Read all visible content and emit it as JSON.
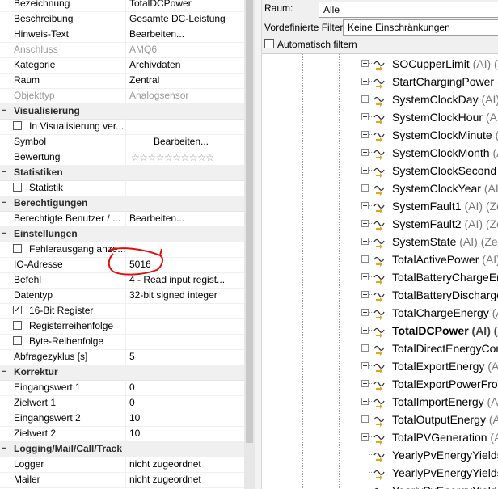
{
  "properties": {
    "rows": [
      {
        "kind": "row",
        "label": "Bezeichnung",
        "value": "TotalDCPower"
      },
      {
        "kind": "row",
        "label": "Beschreibung",
        "value": "Gesamte DC-Leistung"
      },
      {
        "kind": "row",
        "label": "Hinweis-Text",
        "value": "Bearbeiten..."
      },
      {
        "kind": "row",
        "label": "Anschluss",
        "value": "AMQ6",
        "disabled": true
      },
      {
        "kind": "row",
        "label": "Kategorie",
        "value": "Archivdaten"
      },
      {
        "kind": "row",
        "label": "Raum",
        "value": "Zentral"
      },
      {
        "kind": "row",
        "label": "Objekttyp",
        "value": "Analogsensor",
        "disabled": true
      },
      {
        "kind": "cat",
        "label": "Visualisierung",
        "expander": "−"
      },
      {
        "kind": "check",
        "label": "In Visualisierung ver...",
        "checked": false
      },
      {
        "kind": "row",
        "label": "Symbol",
        "value": "Bearbeiten...",
        "center": true
      },
      {
        "kind": "stars",
        "label": "Bewertung",
        "value": "☆☆☆☆☆☆☆☆☆☆"
      },
      {
        "kind": "cat",
        "label": "Statistiken",
        "expander": "−"
      },
      {
        "kind": "check",
        "label": "Statistik",
        "checked": false
      },
      {
        "kind": "cat",
        "label": "Berechtigungen",
        "expander": "−"
      },
      {
        "kind": "row",
        "label": "Berechtigte Benutzer / ...",
        "value": "Bearbeiten..."
      },
      {
        "kind": "cat",
        "label": "Einstellungen",
        "expander": "−"
      },
      {
        "kind": "check",
        "label": "Fehlerausgang anze...",
        "checked": false
      },
      {
        "kind": "row",
        "label": "IO-Adresse",
        "value": "5016"
      },
      {
        "kind": "row",
        "label": "Befehl",
        "value": "4 - Read input regist..."
      },
      {
        "kind": "row",
        "label": "Datentyp",
        "value": "32-bit signed integer"
      },
      {
        "kind": "check",
        "label": "16-Bit Register",
        "checked": true
      },
      {
        "kind": "check",
        "label": "Registerreihenfolge",
        "checked": false
      },
      {
        "kind": "check",
        "label": "Byte-Reihenfolge",
        "checked": false
      },
      {
        "kind": "row",
        "label": "Abfragezyklus [s]",
        "value": "5"
      },
      {
        "kind": "cat",
        "label": "Korrektur",
        "expander": "−"
      },
      {
        "kind": "row",
        "label": "Eingangswert 1",
        "value": "0"
      },
      {
        "kind": "row",
        "label": "Zielwert 1",
        "value": "0"
      },
      {
        "kind": "row",
        "label": "Eingangswert 2",
        "value": "10"
      },
      {
        "kind": "row",
        "label": "Zielwert 2",
        "value": "10"
      },
      {
        "kind": "cat",
        "label": "Logging/Mail/Call/Track",
        "expander": "−"
      },
      {
        "kind": "row",
        "label": "Logger",
        "value": "nicht zugeordnet"
      },
      {
        "kind": "row",
        "label": "Mailer",
        "value": "nicht zugeordnet"
      }
    ]
  },
  "filter": {
    "room_label": "Raum:",
    "room_value": "Alle",
    "preset_label": "Vordefinierte Filter",
    "preset_value": "Keine Einschränkungen",
    "auto_filter_label": "Automatisch filtern",
    "auto_filter_checked": false
  },
  "tree": {
    "items": [
      {
        "name": "SOCupperLimit",
        "suffix": " (AI) (Z"
      },
      {
        "name": "StartChargingPower",
        "suffix": " (AI"
      },
      {
        "name": "SystemClockDay",
        "suffix": " (AI) (Z"
      },
      {
        "name": "SystemClockHour",
        "suffix": " (AI) ("
      },
      {
        "name": "SystemClockMinute",
        "suffix": " (A"
      },
      {
        "name": "SystemClockMonth",
        "suffix": " (AI"
      },
      {
        "name": "SystemClockSecond",
        "suffix": " (A"
      },
      {
        "name": "SystemClockYear",
        "suffix": " (AI) ("
      },
      {
        "name": "SystemFault1",
        "suffix": " (AI) (Ze"
      },
      {
        "name": "SystemFault2",
        "suffix": " (AI) (Ze"
      },
      {
        "name": "SystemState",
        "suffix": " (AI) (Zen"
      },
      {
        "name": "TotalActivePower",
        "suffix": " (AI) ("
      },
      {
        "name": "TotalBatteryChargeEn",
        "suffix": ""
      },
      {
        "name": "TotalBatteryDischarge",
        "suffix": ""
      },
      {
        "name": "TotalChargeEnergy",
        "suffix": " (A"
      },
      {
        "name": "TotalDCPower",
        "suffix": " (AI) (Z",
        "selected": true
      },
      {
        "name": "TotalDirectEnergyCon",
        "suffix": ""
      },
      {
        "name": "TotalExportEnergy",
        "suffix": " (AI"
      },
      {
        "name": "TotalExportPowerFron",
        "suffix": ""
      },
      {
        "name": "TotalImportEnergy",
        "suffix": " (A"
      },
      {
        "name": "TotalOutputEnergy",
        "suffix": " (A"
      },
      {
        "name": "TotalPVGeneration",
        "suffix": " (A"
      },
      {
        "name": "YearlyPvEnergyYields1",
        "suffix": "",
        "noexpander": true
      },
      {
        "name": "YearlyPvEnergyYields2",
        "suffix": "",
        "noexpander": true
      },
      {
        "name": "YearlyPvEnergyYields3",
        "suffix": "",
        "noexpander": true
      }
    ]
  },
  "colors": {
    "annotation": "#e01010",
    "icon_arrow": "#e6a417"
  }
}
